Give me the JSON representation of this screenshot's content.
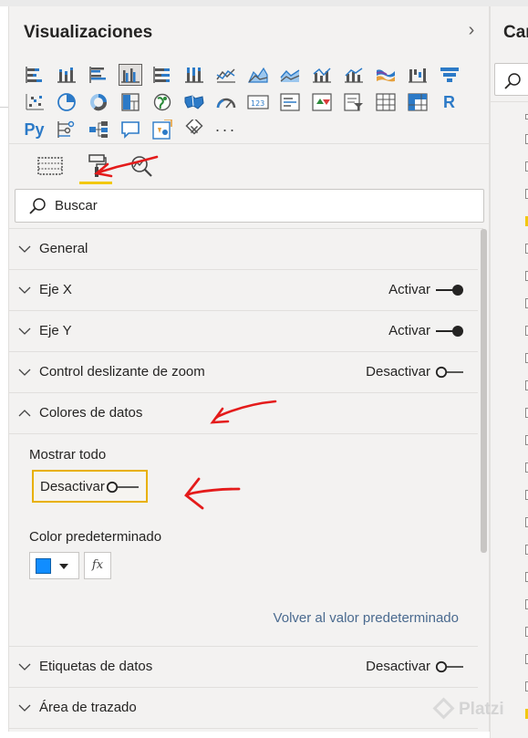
{
  "visualizations": {
    "title": "Visualizaciones",
    "collapse_glyph": "›",
    "icon_rows": [
      [
        "stacked-bar-icon",
        "stacked-column-icon",
        "clustered-bar-icon",
        "clustered-column-icon",
        "100-stacked-bar-icon",
        "100-stacked-column-icon",
        "line-chart-icon",
        "area-chart-icon",
        "stacked-area-icon",
        "line-clustered-column-icon",
        "line-stacked-column-icon",
        "ribbon-chart-icon",
        "waterfall-icon",
        "funnel-icon"
      ],
      [
        "scatter-chart-icon",
        "pie-chart-icon",
        "donut-chart-icon",
        "treemap-icon",
        "map-icon",
        "filled-map-icon",
        "gauge-icon",
        "card-icon",
        "multi-row-card-icon",
        "kpi-icon",
        "slicer-icon",
        "table-icon",
        "matrix-icon",
        "r-visual-icon"
      ],
      [
        "python-visual-icon",
        "key-influencers-icon",
        "decomposition-tree-icon",
        "qa-icon",
        "smart-narrative-icon",
        "power-apps-icon",
        "more-visuals-icon"
      ]
    ],
    "r_label": "R",
    "py_label": "Py",
    "more_label": "···",
    "tabs": [
      "fields-tab-icon",
      "format-paint-roller-icon",
      "analytics-magnifier-icon"
    ],
    "search_placeholder": "Buscar"
  },
  "format_sections": {
    "general": {
      "title": "General"
    },
    "eje_x": {
      "title": "Eje X",
      "state": "Activar",
      "on": true
    },
    "eje_y": {
      "title": "Eje Y",
      "state": "Activar",
      "on": true
    },
    "zoom": {
      "title": "Control deslizante de zoom",
      "state": "Desactivar",
      "on": false
    },
    "colores": {
      "title": "Colores de datos",
      "expanded": true,
      "mostrar_todo_label": "Mostrar todo",
      "mostrar_todo_state": "Desactivar",
      "mostrar_todo_on": false,
      "color_label": "Color predeterminado",
      "default_color": "#118dff",
      "fx_label": "fx",
      "reset_label": "Volver al valor predeterminado"
    },
    "etiquetas": {
      "title": "Etiquetas de datos",
      "state": "Desactivar",
      "on": false
    },
    "area": {
      "title": "Área de trazado"
    }
  },
  "fields_pane": {
    "title": "Car",
    "checkbox_yellow_rows": [
      3,
      21
    ]
  },
  "watermark": {
    "text": "Platzi"
  },
  "colors": {
    "accent_yellow": "#f2c811",
    "highlight_border": "#e8b000",
    "link": "#4a6a8f",
    "annotation_red": "#e41b1b",
    "pane_bg": "#f3f2f1"
  }
}
